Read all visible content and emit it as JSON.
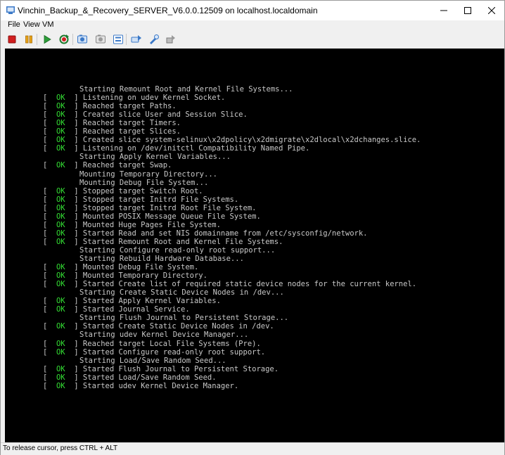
{
  "window": {
    "title": "Vinchin_Backup_&_Recovery_SERVER_V6.0.0.12509 on localhost.localdomain",
    "controls": [
      "minimize-icon",
      "maximize-icon",
      "close-icon"
    ]
  },
  "menu": [
    "File",
    "View",
    "VM"
  ],
  "toolbar": {
    "icons": [
      "stop-icon",
      "pause-icon",
      "play-icon",
      "reset-icon",
      "snapshot-icon",
      "revert-snapshot-icon",
      "manage-snapshots-icon",
      "send-ctrl-alt-del-icon",
      "settings-icon",
      "removable-devices-icon"
    ],
    "colors": {
      "stop": "#d11f1f",
      "pause": "#e8a317",
      "play": "#2e9e3a",
      "reset": "#1c7a2c",
      "blue": "#3a78c7"
    }
  },
  "console": {
    "ok_text": "OK",
    "lines": [
      {
        "status": "",
        "text": "Starting Remount Root and Kernel File Systems..."
      },
      {
        "status": "OK",
        "text": "Listening on udev Kernel Socket."
      },
      {
        "status": "OK",
        "text": "Reached target Paths."
      },
      {
        "status": "OK",
        "text": "Created slice User and Session Slice."
      },
      {
        "status": "OK",
        "text": "Reached target Timers."
      },
      {
        "status": "OK",
        "text": "Reached target Slices."
      },
      {
        "status": "OK",
        "text": "Created slice system-selinux\\x2dpolicy\\x2dmigrate\\x2dlocal\\x2dchanges.slice."
      },
      {
        "status": "OK",
        "text": "Listening on /dev/initctl Compatibility Named Pipe."
      },
      {
        "status": "",
        "text": "Starting Apply Kernel Variables..."
      },
      {
        "status": "OK",
        "text": "Reached target Swap."
      },
      {
        "status": "",
        "text": "Mounting Temporary Directory..."
      },
      {
        "status": "",
        "text": "Mounting Debug File System..."
      },
      {
        "status": "OK",
        "text": "Stopped target Switch Root."
      },
      {
        "status": "OK",
        "text": "Stopped target Initrd File Systems."
      },
      {
        "status": "OK",
        "text": "Stopped target Initrd Root File System."
      },
      {
        "status": "OK",
        "text": "Mounted POSIX Message Queue File System."
      },
      {
        "status": "OK",
        "text": "Mounted Huge Pages File System."
      },
      {
        "status": "OK",
        "text": "Started Read and set NIS domainname from /etc/sysconfig/network."
      },
      {
        "status": "OK",
        "text": "Started Remount Root and Kernel File Systems."
      },
      {
        "status": "",
        "text": "Starting Configure read-only root support..."
      },
      {
        "status": "",
        "text": "Starting Rebuild Hardware Database..."
      },
      {
        "status": "OK",
        "text": "Mounted Debug File System."
      },
      {
        "status": "OK",
        "text": "Mounted Temporary Directory."
      },
      {
        "status": "OK",
        "text": "Started Create list of required static device nodes for the current kernel."
      },
      {
        "status": "",
        "text": "Starting Create Static Device Nodes in /dev..."
      },
      {
        "status": "OK",
        "text": "Started Apply Kernel Variables."
      },
      {
        "status": "OK",
        "text": "Started Journal Service."
      },
      {
        "status": "",
        "text": "Starting Flush Journal to Persistent Storage..."
      },
      {
        "status": "OK",
        "text": "Started Create Static Device Nodes in /dev."
      },
      {
        "status": "",
        "text": "Starting udev Kernel Device Manager..."
      },
      {
        "status": "OK",
        "text": "Reached target Local File Systems (Pre)."
      },
      {
        "status": "OK",
        "text": "Started Configure read-only root support."
      },
      {
        "status": "",
        "text": "Starting Load/Save Random Seed..."
      },
      {
        "status": "OK",
        "text": "Started Flush Journal to Persistent Storage."
      },
      {
        "status": "OK",
        "text": "Started Load/Save Random Seed."
      },
      {
        "status": "OK",
        "text": "Started udev Kernel Device Manager."
      }
    ]
  },
  "statusbar": {
    "text": "To release cursor, press CTRL + ALT"
  }
}
